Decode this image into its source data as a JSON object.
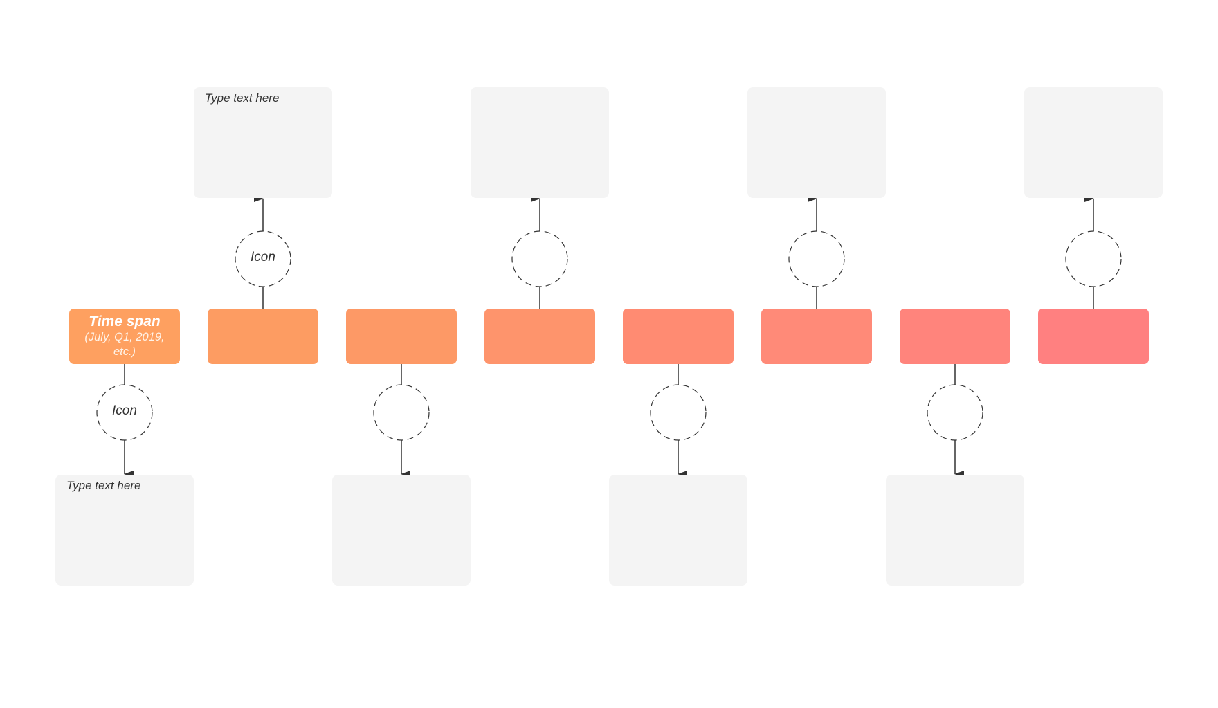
{
  "diagram": {
    "type": "timeline",
    "line_color": "#333333",
    "note_color": "#f4f4f4",
    "steps": [
      {
        "title": "Time span",
        "subtitle": "(July, Q1, 2019, etc.)",
        "color": "#fea060",
        "direction": "down",
        "icon_label": "Icon",
        "note_text": "Type text here"
      },
      {
        "title": "",
        "subtitle": "",
        "color": "#fd9c62",
        "direction": "up",
        "icon_label": "Icon",
        "note_text": "Type text here"
      },
      {
        "title": "",
        "subtitle": "",
        "color": "#fd9966",
        "direction": "down",
        "icon_label": "",
        "note_text": ""
      },
      {
        "title": "",
        "subtitle": "",
        "color": "#fe946c",
        "direction": "up",
        "icon_label": "",
        "note_text": ""
      },
      {
        "title": "",
        "subtitle": "",
        "color": "#ff8b72",
        "direction": "down",
        "icon_label": "",
        "note_text": ""
      },
      {
        "title": "",
        "subtitle": "",
        "color": "#ff8a78",
        "direction": "up",
        "icon_label": "",
        "note_text": ""
      },
      {
        "title": "",
        "subtitle": "",
        "color": "#ff847c",
        "direction": "down",
        "icon_label": "",
        "note_text": ""
      },
      {
        "title": "",
        "subtitle": "",
        "color": "#ff8080",
        "direction": "up",
        "icon_label": "",
        "note_text": ""
      }
    ]
  }
}
